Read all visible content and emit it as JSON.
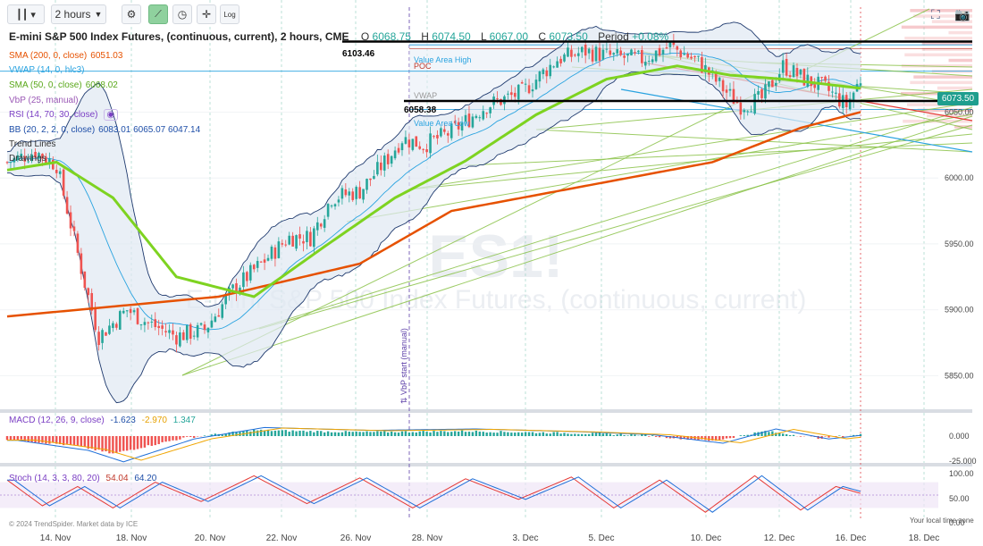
{
  "toolbar": {
    "interval": "2 hours",
    "log_label": "Log"
  },
  "header": {
    "title": "E-mini S&P 500 Index Futures, (continuous, current), 2 hours, CME",
    "ohlc": {
      "o_label": "O",
      "o": "6068.75",
      "h_label": "H",
      "h": "6074.50",
      "l_label": "L",
      "l": "6067.00",
      "c_label": "C",
      "c": "6073.50",
      "period_label": "Period",
      "period": "+0.08%"
    }
  },
  "indicators": [
    {
      "label": "SMA (200, 0, close)",
      "value": "6051.03",
      "color": "#e65100"
    },
    {
      "label": "VWAP (14, 0, hlc3)",
      "value": "",
      "color": "#29a3e0"
    },
    {
      "label": "SMA (50, 0, close)",
      "value": "6068.02",
      "color": "#7ed321"
    },
    {
      "label": "VbP (25, manual)",
      "value": "",
      "color": "#9b59b6"
    },
    {
      "label": "RSI (14, 70, 30, close)",
      "value": "",
      "color": "#7b3fc4"
    },
    {
      "label": "BB (20, 2, 2, 0, close)",
      "value": "6083.01 6065.07 6047.14",
      "color": "#1f4fa8"
    },
    {
      "label": "Trend Lines",
      "value": "",
      "color": "#333333"
    },
    {
      "label": "Drawings",
      "value": "",
      "color": "#333333"
    }
  ],
  "annotations": {
    "level_high": "6103.46",
    "level_low": "6058.38",
    "value_area_high": "Value Area High",
    "poc": "POC",
    "vwap": "VWAP",
    "value_area_low": "Value Area Low",
    "vbp_start": "⇅ VbP start (manual)",
    "watermark_symbol": "ES1!",
    "watermark_name": "E-mini S&P 500 Index Futures, (continuous, current)",
    "copyright": "© 2024 TrendSpider. Market data by ICE",
    "timezone": "Your local time zone"
  },
  "price_label": "6073.50",
  "macd": {
    "label": "MACD (12, 26, 9, close)",
    "v1": "-1.623",
    "v2": "-2.970",
    "v3": "1.347",
    "ticks": [
      "0.000",
      "-25.000"
    ]
  },
  "stoch": {
    "label": "Stoch (14, 3, 3, 80, 20)",
    "v1": "54.04",
    "v2": "64.20",
    "ticks": [
      "100.00",
      "50.00",
      "0.00"
    ]
  },
  "colors": {
    "up": "#26a69a",
    "down": "#ef5350",
    "sma200": "#e65100",
    "sma50": "#7ed321",
    "bb": "#1f3a6e",
    "trend": "#8bc34a",
    "level": "#000000",
    "vwap_line": "#29a3e0"
  },
  "chart_data": {
    "type": "candlestick",
    "x_ticks": [
      "14. Nov",
      "18. Nov",
      "20. Nov",
      "22. Nov",
      "26. Nov",
      "28. Nov",
      "3. Dec",
      "5. Dec",
      "10. Dec",
      "12. Dec",
      "16. Dec",
      "18. Dec"
    ],
    "y_ticks": [
      6050,
      6000,
      5950,
      5900,
      5850
    ],
    "y_tick_labels": [
      "6050.00",
      "6000.00",
      "5950.00",
      "5900.00",
      "5850.00"
    ],
    "ylim": [
      5830,
      6135
    ],
    "levels": [
      6103.46,
      6058.38
    ],
    "close_keypoints": [
      [
        0,
        6012
      ],
      [
        8,
        6020
      ],
      [
        14,
        6010
      ],
      [
        22,
        5920
      ],
      [
        26,
        5880
      ],
      [
        34,
        5900
      ],
      [
        40,
        5890
      ],
      [
        48,
        5880
      ],
      [
        56,
        5885
      ],
      [
        64,
        5915
      ],
      [
        72,
        5935
      ],
      [
        80,
        5955
      ],
      [
        86,
        5955
      ],
      [
        92,
        5985
      ],
      [
        100,
        5990
      ],
      [
        108,
        6015
      ],
      [
        112,
        6030
      ],
      [
        118,
        6025
      ],
      [
        126,
        6035
      ],
      [
        136,
        6055
      ],
      [
        146,
        6065
      ],
      [
        156,
        6090
      ],
      [
        164,
        6096
      ],
      [
        172,
        6092
      ],
      [
        180,
        6090
      ],
      [
        188,
        6100
      ],
      [
        196,
        6088
      ],
      [
        204,
        6065
      ],
      [
        208,
        6055
      ],
      [
        214,
        6060
      ],
      [
        220,
        6085
      ],
      [
        226,
        6075
      ],
      [
        232,
        6068
      ],
      [
        238,
        6055
      ],
      [
        242,
        6075
      ]
    ],
    "sma200_keypoints": [
      [
        0,
        5895
      ],
      [
        60,
        5910
      ],
      [
        100,
        5935
      ],
      [
        126,
        5975
      ],
      [
        160,
        5992
      ],
      [
        200,
        6012
      ],
      [
        225,
        6038
      ],
      [
        242,
        6050
      ]
    ],
    "sma50_keypoints": [
      [
        0,
        6006
      ],
      [
        14,
        6012
      ],
      [
        30,
        5985
      ],
      [
        48,
        5925
      ],
      [
        70,
        5910
      ],
      [
        90,
        5948
      ],
      [
        110,
        5985
      ],
      [
        130,
        6013
      ],
      [
        150,
        6048
      ],
      [
        170,
        6075
      ],
      [
        190,
        6085
      ],
      [
        205,
        6078
      ],
      [
        220,
        6075
      ],
      [
        242,
        6068
      ]
    ],
    "macd": {
      "ylim": [
        -30,
        25
      ],
      "hist_keypoints": [
        [
          0,
          -3
        ],
        [
          20,
          -10
        ],
        [
          30,
          -18
        ],
        [
          50,
          -2
        ],
        [
          70,
          6
        ],
        [
          100,
          4
        ],
        [
          130,
          5
        ],
        [
          160,
          3
        ],
        [
          180,
          1
        ],
        [
          200,
          -5
        ],
        [
          215,
          5
        ],
        [
          230,
          -2
        ],
        [
          242,
          1.3
        ]
      ]
    },
    "stoch": {
      "ylim": [
        0,
        100
      ],
      "keypoints": [
        [
          0,
          85
        ],
        [
          10,
          25
        ],
        [
          20,
          70
        ],
        [
          30,
          20
        ],
        [
          42,
          80
        ],
        [
          55,
          35
        ],
        [
          70,
          95
        ],
        [
          85,
          30
        ],
        [
          100,
          90
        ],
        [
          115,
          20
        ],
        [
          130,
          88
        ],
        [
          145,
          40
        ],
        [
          160,
          92
        ],
        [
          172,
          20
        ],
        [
          185,
          85
        ],
        [
          198,
          10
        ],
        [
          212,
          95
        ],
        [
          225,
          15
        ],
        [
          235,
          70
        ],
        [
          242,
          54
        ]
      ]
    }
  }
}
